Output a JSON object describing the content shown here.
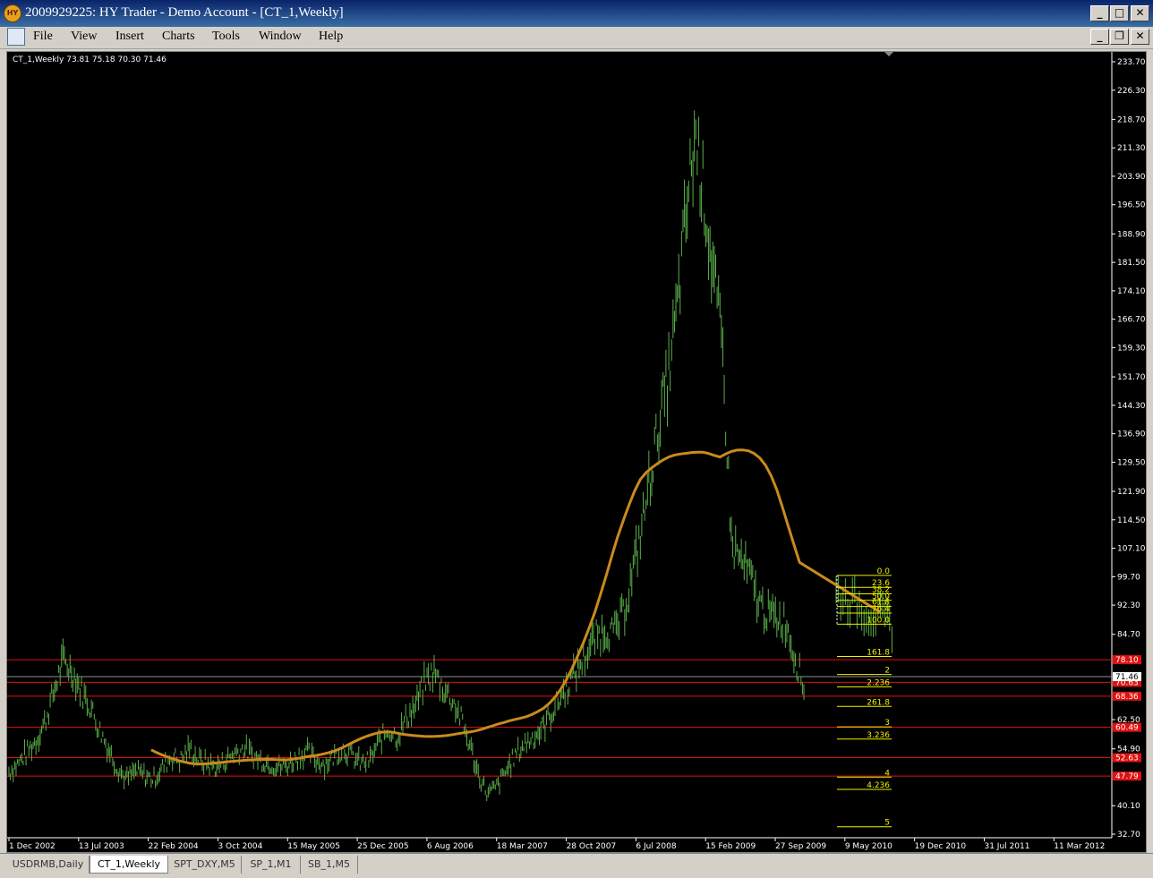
{
  "window": {
    "title": "2009929225: HY Trader - Demo Account - [CT_1,Weekly]",
    "app_icon_text": "HY",
    "minimize_glyph": "_",
    "maximize_glyph": "□",
    "restore_glyph": "❐",
    "close_glyph": "✕"
  },
  "menu": [
    "File",
    "View",
    "Insert",
    "Charts",
    "Tools",
    "Window",
    "Help"
  ],
  "chart": {
    "header": "CT_1,Weekly  73.81 75.18 70.30 71.46",
    "colors": {
      "background": "#000000",
      "bars": "#5ab04a",
      "ma": "#c98a1e",
      "hline": "#e01010",
      "fib": "#f0f000",
      "axis": "#ffffff",
      "gray_line": "#909090"
    },
    "price_labels": [
      "233.70",
      "226.30",
      "218.70",
      "211.30",
      "203.90",
      "196.50",
      "188.90",
      "181.50",
      "174.10",
      "166.70",
      "159.30",
      "151.70",
      "144.30",
      "136.90",
      "129.50",
      "121.90",
      "114.50",
      "107.10",
      "99.70",
      "92.30",
      "84.70",
      "62.50",
      "54.90",
      "40.10",
      "32.70"
    ],
    "date_labels": [
      "1 Dec 2002",
      "13 Jul 2003",
      "22 Feb 2004",
      "3 Oct 2004",
      "15 May 2005",
      "25 Dec 2005",
      "6 Aug 2006",
      "18 Mar 2007",
      "28 Oct 2007",
      "6 Jul 2008",
      "15 Feb 2009",
      "27 Sep 2009",
      "9 May 2010",
      "19 Dec 2010",
      "31 Jul 2011",
      "11 Mar 2012"
    ],
    "red_levels": [
      {
        "value": "78.10",
        "price": 78.1
      },
      {
        "value": "70.63",
        "price": 72.2
      },
      {
        "value": "68.36",
        "price": 68.6
      },
      {
        "value": "60.49",
        "price": 60.5
      },
      {
        "value": "52.63",
        "price": 52.6
      },
      {
        "value": "47.79",
        "price": 47.8
      }
    ],
    "gray_levels": [
      {
        "value": "71.46",
        "price": 73.7
      }
    ],
    "fib_labels": [
      {
        "text": "0.0",
        "price": 100.5
      },
      {
        "text": "23.6",
        "price": 97.4
      },
      {
        "text": "38.2",
        "price": 95.7
      },
      {
        "text": "50.0",
        "price": 94.0
      },
      {
        "text": "61.8",
        "price": 92.4
      },
      {
        "text": "76.4",
        "price": 90.7
      },
      {
        "text": "100.0",
        "price": 87.8
      },
      {
        "text": "161.8",
        "price": 79.4
      },
      {
        "text": "2",
        "price": 74.7
      },
      {
        "text": "2.236",
        "price": 71.5
      },
      {
        "text": "261.8",
        "price": 66.4
      },
      {
        "text": "3",
        "price": 61.1
      },
      {
        "text": "3.236",
        "price": 57.9
      },
      {
        "text": "4",
        "price": 48.0
      },
      {
        "text": "4.236",
        "price": 44.8
      },
      {
        "text": "5",
        "price": 35.1
      }
    ],
    "series": [
      {
        "p": 49
      },
      {
        "p": 51
      },
      {
        "p": 54
      },
      {
        "p": 57
      },
      {
        "p": 62
      },
      {
        "p": 70
      },
      {
        "p": 78
      },
      {
        "p": 75
      },
      {
        "p": 70
      },
      {
        "p": 66
      },
      {
        "p": 60
      },
      {
        "p": 55
      },
      {
        "p": 50
      },
      {
        "p": 47
      },
      {
        "p": 49
      },
      {
        "p": 48
      },
      {
        "p": 47
      },
      {
        "p": 50
      },
      {
        "p": 53
      },
      {
        "p": 52
      },
      {
        "p": 55
      },
      {
        "p": 52
      },
      {
        "p": 51
      },
      {
        "p": 50
      },
      {
        "p": 52
      },
      {
        "p": 54
      },
      {
        "p": 55
      },
      {
        "p": 53
      },
      {
        "p": 52
      },
      {
        "p": 51
      },
      {
        "p": 50
      },
      {
        "p": 51
      },
      {
        "p": 53
      },
      {
        "p": 54
      },
      {
        "p": 52
      },
      {
        "p": 51
      },
      {
        "p": 53
      },
      {
        "p": 55
      },
      {
        "p": 53
      },
      {
        "p": 51
      },
      {
        "p": 52
      },
      {
        "p": 57
      },
      {
        "p": 60
      },
      {
        "p": 58
      },
      {
        "p": 63
      },
      {
        "p": 66
      },
      {
        "p": 72
      },
      {
        "p": 75
      },
      {
        "p": 71
      },
      {
        "p": 68
      },
      {
        "p": 63
      },
      {
        "p": 56
      },
      {
        "p": 48
      },
      {
        "p": 43
      },
      {
        "p": 45
      },
      {
        "p": 49
      },
      {
        "p": 53
      },
      {
        "p": 56
      },
      {
        "p": 58
      },
      {
        "p": 60
      },
      {
        "p": 64
      },
      {
        "p": 68
      },
      {
        "p": 72
      },
      {
        "p": 76
      },
      {
        "p": 80
      },
      {
        "p": 84
      },
      {
        "p": 86
      },
      {
        "p": 85
      },
      {
        "p": 90
      },
      {
        "p": 100
      },
      {
        "p": 112
      },
      {
        "p": 126
      },
      {
        "p": 140
      },
      {
        "p": 152
      },
      {
        "p": 170
      },
      {
        "p": 195
      },
      {
        "p": 215
      },
      {
        "p": 198
      },
      {
        "p": 178
      },
      {
        "p": 158
      },
      {
        "p": 108
      },
      {
        "p": 104
      },
      {
        "p": 100
      },
      {
        "p": 93
      },
      {
        "p": 90
      },
      {
        "p": 89
      },
      {
        "p": 88
      },
      {
        "p": 79
      },
      {
        "p": 71
      }
    ]
  },
  "tabs": [
    {
      "label": "USDRMB,Daily",
      "active": false
    },
    {
      "label": "CT_1,Weekly",
      "active": true
    },
    {
      "label": "SPT_DXY,M5",
      "active": false
    },
    {
      "label": "SP_1,M1",
      "active": false
    },
    {
      "label": "SB_1,M5",
      "active": false
    }
  ]
}
